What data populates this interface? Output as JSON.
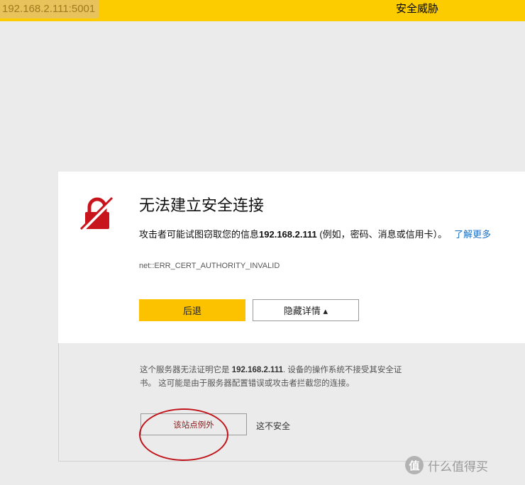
{
  "address_bar": {
    "url": "192.168.2.111:5001",
    "threat_label": "安全威胁"
  },
  "warning": {
    "title": "无法建立安全连接",
    "desc_prefix": "攻击者可能试图窃取您的信息",
    "desc_host": "192.168.2.111",
    "desc_suffix": " (例如，密码、消息或信用卡）。",
    "learn_more": "了解更多",
    "error_code": "net::ERR_CERT_AUTHORITY_INVALID",
    "back_button": "后退",
    "hide_details_button": "隐藏详情 ▴"
  },
  "details": {
    "line1_prefix": "这个服务器无法证明它是 ",
    "line1_host": "192.168.2.111",
    "line1_suffix": ". 设备的操作系统不接受其安全证",
    "line2": "书。 这可能是由于服务器配置错误或攻击者拦截您的连接。",
    "exception_button": "该站点例外",
    "unsafe_label": "这不安全"
  },
  "watermark": {
    "icon_glyph": "值",
    "text": "什么值得买"
  },
  "colors": {
    "accent": "#fcc200",
    "lock": "#c8141c",
    "annotation": "#c0141a"
  },
  "icons": {
    "lock": "broken-lock-icon"
  }
}
